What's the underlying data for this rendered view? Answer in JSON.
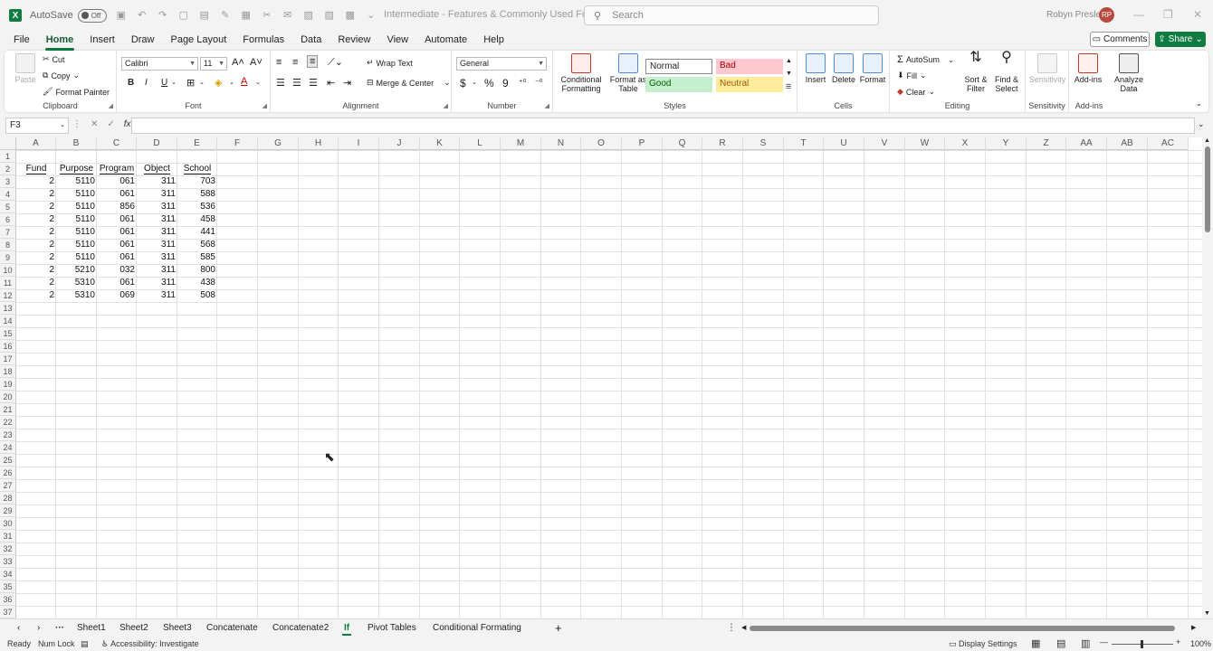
{
  "titlebar": {
    "logo": "X",
    "autosave_label": "AutoSave",
    "autosave_state": "Off",
    "doc_title": "Intermediate - Features & Commonly Used Funct...",
    "search_placeholder": "Search",
    "user_name": "Robyn Presley",
    "user_initials": "RP"
  },
  "ribbon_tabs": [
    "File",
    "Home",
    "Insert",
    "Draw",
    "Page Layout",
    "Formulas",
    "Data",
    "Review",
    "View",
    "Automate",
    "Help"
  ],
  "active_tab": "Home",
  "actions": {
    "comments": "Comments",
    "share": "Share"
  },
  "ribbon": {
    "clipboard": {
      "label": "Clipboard",
      "paste": "Paste",
      "cut": "Cut",
      "copy": "Copy",
      "format_painter": "Format Painter"
    },
    "font": {
      "label": "Font",
      "font_name": "Calibri",
      "font_size": "11",
      "bold": "B",
      "italic": "I",
      "underline": "U"
    },
    "alignment": {
      "label": "Alignment",
      "wrap_text": "Wrap Text",
      "merge_center": "Merge & Center"
    },
    "number": {
      "label": "Number",
      "format": "General"
    },
    "styles": {
      "label": "Styles",
      "conditional_formatting": "Conditional Formatting",
      "format_as_table": "Format as Table",
      "normal": "Normal",
      "bad": "Bad",
      "good": "Good",
      "neutral": "Neutral"
    },
    "cells": {
      "label": "Cells",
      "insert": "Insert",
      "delete": "Delete",
      "format": "Format"
    },
    "editing": {
      "label": "Editing",
      "autosum": "AutoSum",
      "fill": "Fill",
      "clear": "Clear",
      "sort_filter": "Sort & Filter",
      "find_select": "Find & Select"
    },
    "sensitivity": {
      "label": "Sensitivity",
      "button": "Sensitivity"
    },
    "addins": {
      "label": "Add-ins",
      "button": "Add-ins",
      "analyze": "Analyze Data"
    }
  },
  "formula_bar": {
    "name_box": "F3",
    "fx": "fx",
    "formula": ""
  },
  "colors": {
    "accent": "#107c41",
    "bad_bg": "#ffc7ce",
    "bad_fg": "#9c0006",
    "good_bg": "#c6efce",
    "good_fg": "#006100",
    "neutral_bg": "#ffeb9c",
    "neutral_fg": "#9c5700"
  },
  "columns": [
    "A",
    "B",
    "C",
    "D",
    "E",
    "F",
    "G",
    "H",
    "I",
    "J",
    "K",
    "L",
    "M",
    "N",
    "O",
    "P",
    "Q",
    "R",
    "S",
    "T",
    "U",
    "V",
    "W",
    "X",
    "Y",
    "Z",
    "AA",
    "AB",
    "AC"
  ],
  "table": {
    "headers": [
      "Fund",
      "Purpose",
      "Program",
      "Object",
      "School"
    ],
    "rows": [
      [
        "2",
        "5110",
        "061",
        "311",
        "703"
      ],
      [
        "2",
        "5110",
        "061",
        "311",
        "588"
      ],
      [
        "2",
        "5110",
        "856",
        "311",
        "536"
      ],
      [
        "2",
        "5110",
        "061",
        "311",
        "458"
      ],
      [
        "2",
        "5110",
        "061",
        "311",
        "441"
      ],
      [
        "2",
        "5110",
        "061",
        "311",
        "568"
      ],
      [
        "2",
        "5110",
        "061",
        "311",
        "585"
      ],
      [
        "2",
        "5210",
        "032",
        "311",
        "800"
      ],
      [
        "2",
        "5310",
        "061",
        "311",
        "438"
      ],
      [
        "2",
        "5310",
        "069",
        "311",
        "508"
      ]
    ]
  },
  "sheets": [
    "Sheet1",
    "Sheet2",
    "Sheet3",
    "Concatenate",
    "Concatenate2",
    "If",
    "Pivot Tables",
    "Conditional Formating"
  ],
  "active_sheet": "If",
  "status": {
    "ready": "Ready",
    "num_lock": "Num Lock",
    "accessibility": "Accessibility: Investigate",
    "display_settings": "Display Settings",
    "zoom": "100%"
  }
}
